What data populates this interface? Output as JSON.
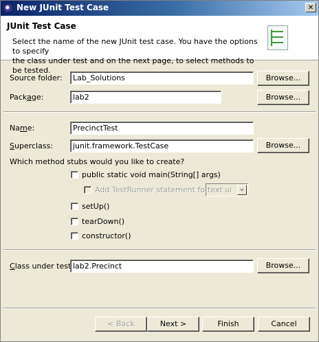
{
  "window": {
    "title": "New JUnit Test Case"
  },
  "header": {
    "title": "JUnit Test Case",
    "description_line1": "Select the name of the new JUnit test case. You have the options to specify",
    "description_line2": "the class under test and on the next page, to select methods to be tested."
  },
  "fields": {
    "source_folder": {
      "label": "Source folder:",
      "value": "Lab_Solutions"
    },
    "package": {
      "label_pre": "Pack",
      "label_key": "a",
      "label_post": "ge:",
      "value": "lab2"
    },
    "name": {
      "label_pre": "Na",
      "label_key": "m",
      "label_post": "e:",
      "value": "PrecinctTest"
    },
    "superclass": {
      "label_pre": "",
      "label_key": "S",
      "label_post": "uperclass:",
      "value": "junit.framework.TestCase"
    },
    "class_under_test": {
      "label_pre": "",
      "label_key": "C",
      "label_post": "lass under test:",
      "value": "lab2.Precinct"
    }
  },
  "browse_label": "Browse...",
  "stubs": {
    "question": "Which method stubs would you like to create?",
    "main_label": "public static void main(String[] args)",
    "testrunner_label": "Add TestRunner statement for:",
    "testrunner_value": "text ui",
    "setup_label": "setUp()",
    "teardown_label": "tearDown()",
    "constructor_label": "constructor()"
  },
  "buttons": {
    "back": "< Back",
    "next": "Next >",
    "finish": "Finish",
    "cancel": "Cancel"
  }
}
